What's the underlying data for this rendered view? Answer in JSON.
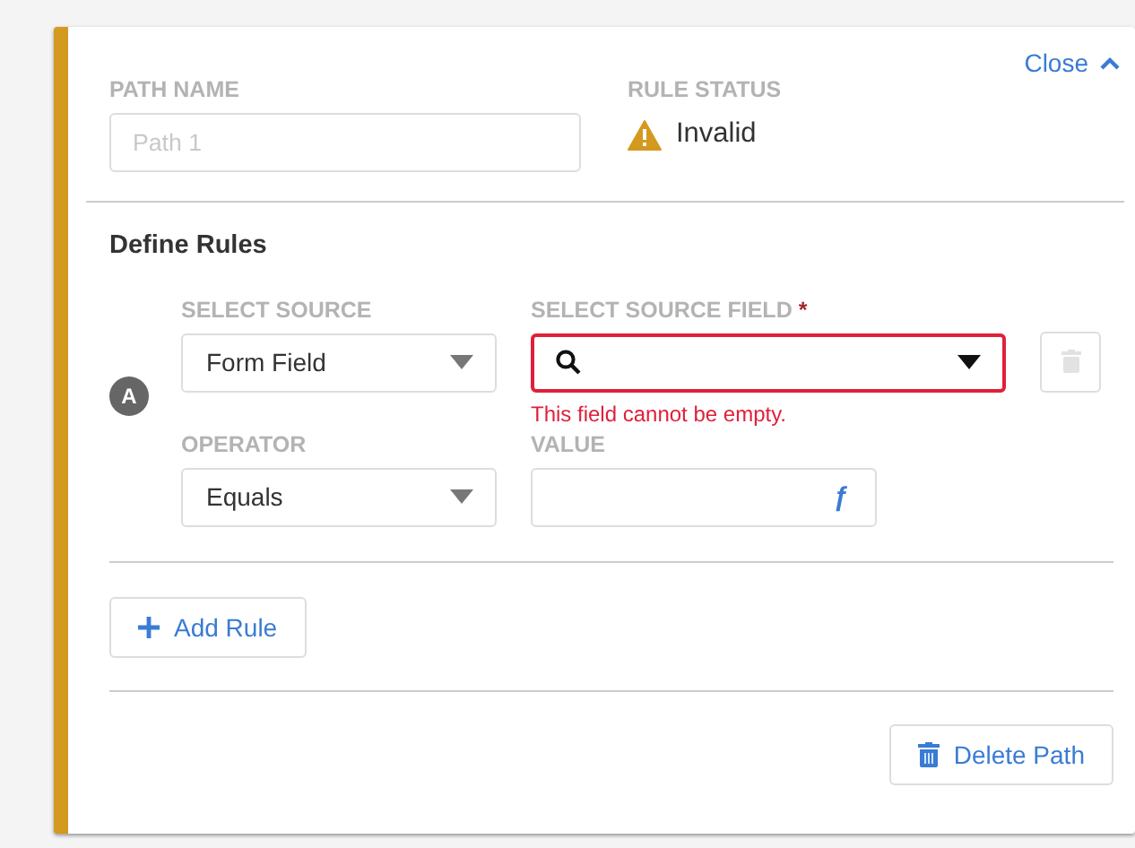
{
  "close_link": "Close",
  "path_name": {
    "label": "PATH NAME",
    "placeholder": "Path 1"
  },
  "rule_status": {
    "label": "RULE STATUS",
    "value": "Invalid",
    "kind": "warning"
  },
  "section_title": "Define Rules",
  "rules": [
    {
      "badge": "A",
      "source": {
        "label": "SELECT SOURCE",
        "value": "Form Field"
      },
      "source_field": {
        "label": "SELECT SOURCE FIELD",
        "required_mark": "*",
        "error": "This field cannot be empty."
      },
      "operator": {
        "label": "OPERATOR",
        "value": "Equals"
      },
      "value": {
        "label": "VALUE",
        "function_button": "ƒ"
      },
      "delete_disabled": true
    }
  ],
  "add_rule_button": "Add Rule",
  "delete_path_button": "Delete Path"
}
